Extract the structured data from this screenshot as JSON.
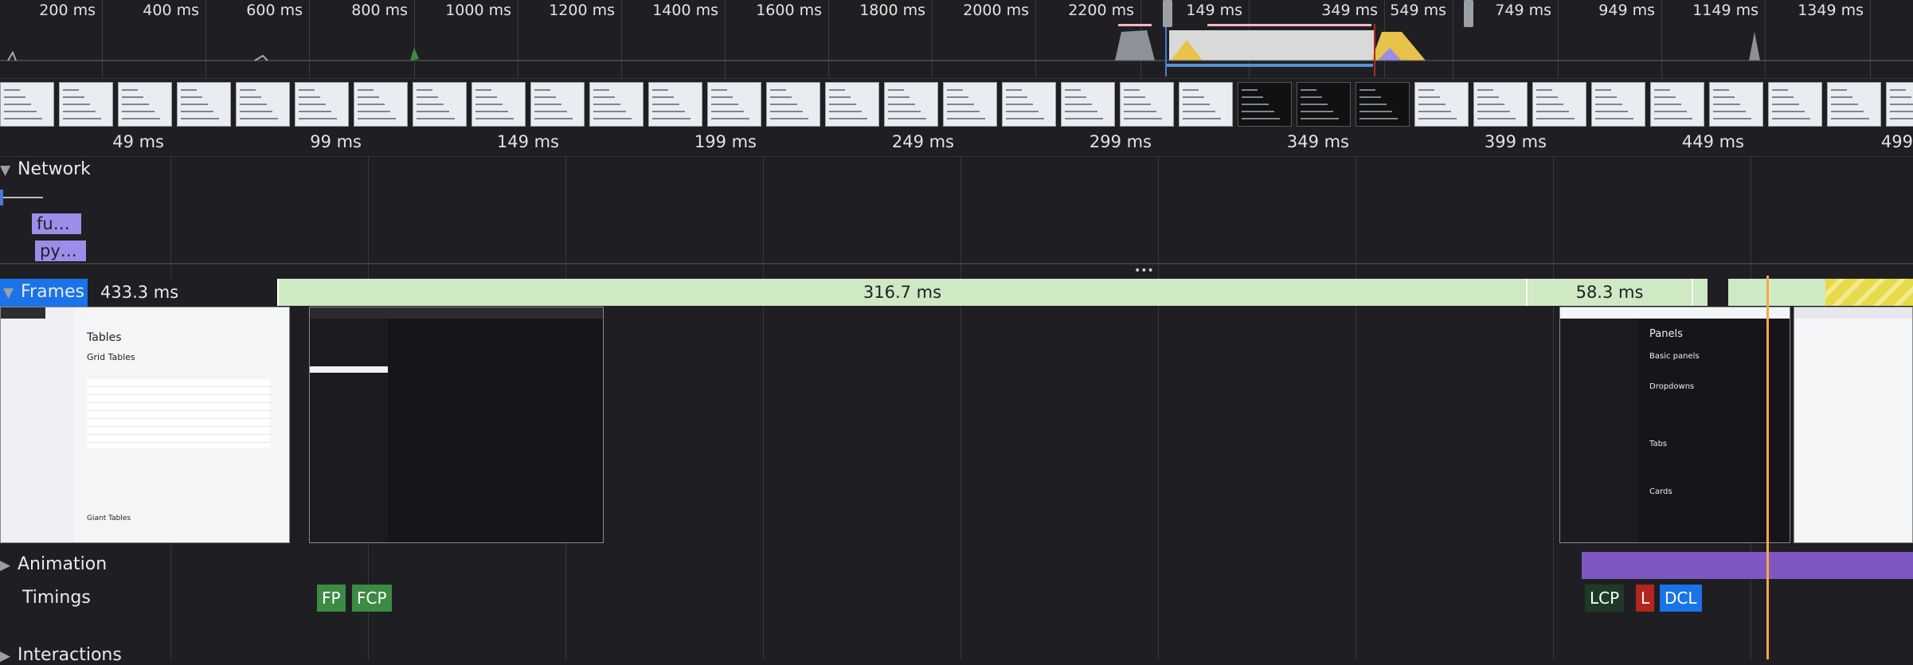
{
  "overview": {
    "ticks": [
      "200 ms",
      "400 ms",
      "600 ms",
      "800 ms",
      "1000 ms",
      "1200 ms",
      "1400 ms",
      "1600 ms",
      "1800 ms",
      "2000 ms",
      "2200 ms",
      "149 ms",
      "349 ms",
      "549 ms",
      "749 ms",
      "949 ms",
      "1149 ms",
      "1349 ms"
    ]
  },
  "main_ticks": [
    "49 ms",
    "99 ms",
    "149 ms",
    "199 ms",
    "249 ms",
    "299 ms",
    "349 ms",
    "399 ms",
    "449 ms",
    "499"
  ],
  "tracks": {
    "network": {
      "label": "Network",
      "requests": [
        "fu…",
        "py…"
      ]
    },
    "frames": {
      "label": "Frames",
      "segments": [
        "433.3 ms",
        "316.7 ms",
        "58.3 ms"
      ]
    },
    "animation": {
      "label": "Animation"
    },
    "timings": {
      "label": "Timings",
      "markers": [
        "FP",
        "FCP",
        "LCP",
        "L",
        "DCL"
      ]
    },
    "interactions": {
      "label": "Interactions"
    }
  },
  "colors": {
    "fp": "#3c8b43",
    "fcp": "#3c8b43",
    "lcp": "#1e3a26",
    "l": "#b3261e",
    "dcl": "#1a73e8",
    "network_bar": "#9c8dea",
    "frames_bg": "#cfe9c4",
    "animation": "#7e57c2",
    "marker_line": "#f6a94a"
  },
  "snapshot_text": {
    "page_title": "Tables",
    "section_title": "Grid Tables",
    "panels_title": "Panels",
    "basic_panels": "Basic panels",
    "dropdowns": "Dropdowns",
    "tabs": "Tabs",
    "cards": "Cards",
    "giant_tables": "Giant Tables"
  }
}
